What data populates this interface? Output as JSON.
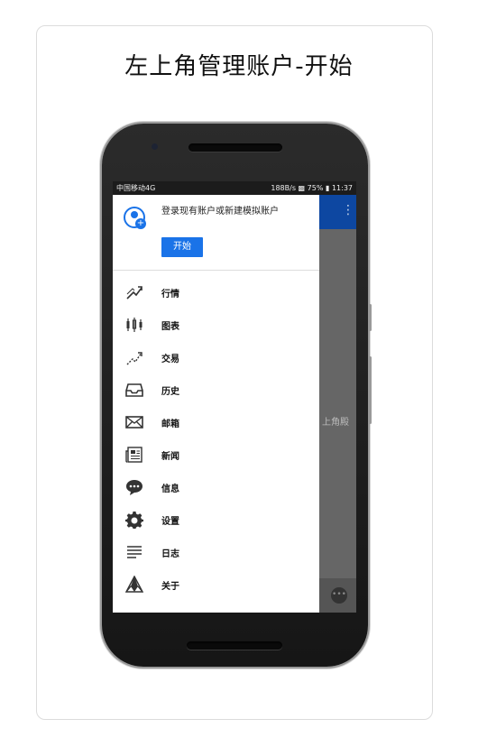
{
  "page_title": "左上角管理账户-开始",
  "status_bar": {
    "left": "中国移动4G",
    "speed": "188B/s",
    "battery": "75%",
    "time": "11:37"
  },
  "background": {
    "partial_text": "上角殿"
  },
  "drawer": {
    "header_text": "登录现有账户或新建模拟账户",
    "start_button": "开始",
    "items": [
      {
        "label": "行情",
        "icon": "quotes-icon"
      },
      {
        "label": "图表",
        "icon": "chart-candles-icon"
      },
      {
        "label": "交易",
        "icon": "trade-icon"
      },
      {
        "label": "历史",
        "icon": "history-inbox-icon"
      },
      {
        "label": "邮箱",
        "icon": "mail-icon"
      },
      {
        "label": "新闻",
        "icon": "news-icon"
      },
      {
        "label": "信息",
        "icon": "chat-icon"
      },
      {
        "label": "设置",
        "icon": "gear-icon"
      },
      {
        "label": "日志",
        "icon": "log-icon"
      },
      {
        "label": "关于",
        "icon": "about-icon"
      }
    ]
  },
  "colors": {
    "accent": "#1a73e8",
    "appbar": "#0d47a1"
  }
}
